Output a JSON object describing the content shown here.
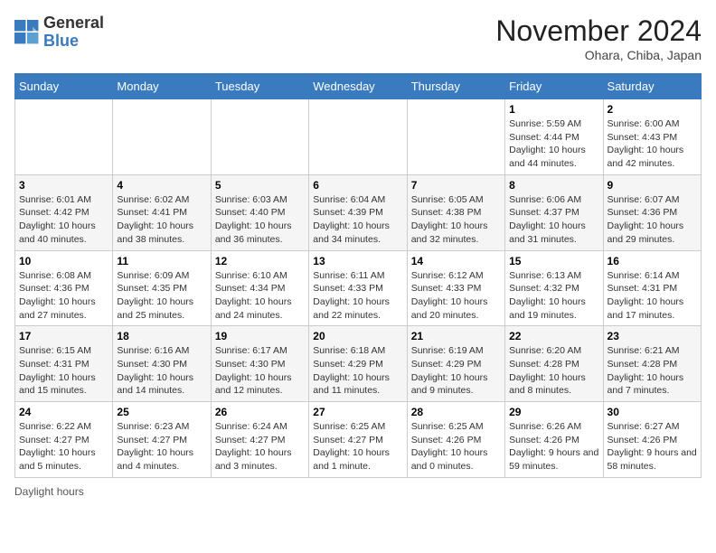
{
  "header": {
    "logo_general": "General",
    "logo_blue": "Blue",
    "month_title": "November 2024",
    "location": "Ohara, Chiba, Japan"
  },
  "days_of_week": [
    "Sunday",
    "Monday",
    "Tuesday",
    "Wednesday",
    "Thursday",
    "Friday",
    "Saturday"
  ],
  "footer": {
    "daylight_label": "Daylight hours"
  },
  "weeks": [
    [
      {
        "day": "",
        "info": ""
      },
      {
        "day": "",
        "info": ""
      },
      {
        "day": "",
        "info": ""
      },
      {
        "day": "",
        "info": ""
      },
      {
        "day": "",
        "info": ""
      },
      {
        "day": "1",
        "info": "Sunrise: 5:59 AM\nSunset: 4:44 PM\nDaylight: 10 hours and 44 minutes."
      },
      {
        "day": "2",
        "info": "Sunrise: 6:00 AM\nSunset: 4:43 PM\nDaylight: 10 hours and 42 minutes."
      }
    ],
    [
      {
        "day": "3",
        "info": "Sunrise: 6:01 AM\nSunset: 4:42 PM\nDaylight: 10 hours and 40 minutes."
      },
      {
        "day": "4",
        "info": "Sunrise: 6:02 AM\nSunset: 4:41 PM\nDaylight: 10 hours and 38 minutes."
      },
      {
        "day": "5",
        "info": "Sunrise: 6:03 AM\nSunset: 4:40 PM\nDaylight: 10 hours and 36 minutes."
      },
      {
        "day": "6",
        "info": "Sunrise: 6:04 AM\nSunset: 4:39 PM\nDaylight: 10 hours and 34 minutes."
      },
      {
        "day": "7",
        "info": "Sunrise: 6:05 AM\nSunset: 4:38 PM\nDaylight: 10 hours and 32 minutes."
      },
      {
        "day": "8",
        "info": "Sunrise: 6:06 AM\nSunset: 4:37 PM\nDaylight: 10 hours and 31 minutes."
      },
      {
        "day": "9",
        "info": "Sunrise: 6:07 AM\nSunset: 4:36 PM\nDaylight: 10 hours and 29 minutes."
      }
    ],
    [
      {
        "day": "10",
        "info": "Sunrise: 6:08 AM\nSunset: 4:36 PM\nDaylight: 10 hours and 27 minutes."
      },
      {
        "day": "11",
        "info": "Sunrise: 6:09 AM\nSunset: 4:35 PM\nDaylight: 10 hours and 25 minutes."
      },
      {
        "day": "12",
        "info": "Sunrise: 6:10 AM\nSunset: 4:34 PM\nDaylight: 10 hours and 24 minutes."
      },
      {
        "day": "13",
        "info": "Sunrise: 6:11 AM\nSunset: 4:33 PM\nDaylight: 10 hours and 22 minutes."
      },
      {
        "day": "14",
        "info": "Sunrise: 6:12 AM\nSunset: 4:33 PM\nDaylight: 10 hours and 20 minutes."
      },
      {
        "day": "15",
        "info": "Sunrise: 6:13 AM\nSunset: 4:32 PM\nDaylight: 10 hours and 19 minutes."
      },
      {
        "day": "16",
        "info": "Sunrise: 6:14 AM\nSunset: 4:31 PM\nDaylight: 10 hours and 17 minutes."
      }
    ],
    [
      {
        "day": "17",
        "info": "Sunrise: 6:15 AM\nSunset: 4:31 PM\nDaylight: 10 hours and 15 minutes."
      },
      {
        "day": "18",
        "info": "Sunrise: 6:16 AM\nSunset: 4:30 PM\nDaylight: 10 hours and 14 minutes."
      },
      {
        "day": "19",
        "info": "Sunrise: 6:17 AM\nSunset: 4:30 PM\nDaylight: 10 hours and 12 minutes."
      },
      {
        "day": "20",
        "info": "Sunrise: 6:18 AM\nSunset: 4:29 PM\nDaylight: 10 hours and 11 minutes."
      },
      {
        "day": "21",
        "info": "Sunrise: 6:19 AM\nSunset: 4:29 PM\nDaylight: 10 hours and 9 minutes."
      },
      {
        "day": "22",
        "info": "Sunrise: 6:20 AM\nSunset: 4:28 PM\nDaylight: 10 hours and 8 minutes."
      },
      {
        "day": "23",
        "info": "Sunrise: 6:21 AM\nSunset: 4:28 PM\nDaylight: 10 hours and 7 minutes."
      }
    ],
    [
      {
        "day": "24",
        "info": "Sunrise: 6:22 AM\nSunset: 4:27 PM\nDaylight: 10 hours and 5 minutes."
      },
      {
        "day": "25",
        "info": "Sunrise: 6:23 AM\nSunset: 4:27 PM\nDaylight: 10 hours and 4 minutes."
      },
      {
        "day": "26",
        "info": "Sunrise: 6:24 AM\nSunset: 4:27 PM\nDaylight: 10 hours and 3 minutes."
      },
      {
        "day": "27",
        "info": "Sunrise: 6:25 AM\nSunset: 4:27 PM\nDaylight: 10 hours and 1 minute."
      },
      {
        "day": "28",
        "info": "Sunrise: 6:25 AM\nSunset: 4:26 PM\nDaylight: 10 hours and 0 minutes."
      },
      {
        "day": "29",
        "info": "Sunrise: 6:26 AM\nSunset: 4:26 PM\nDaylight: 9 hours and 59 minutes."
      },
      {
        "day": "30",
        "info": "Sunrise: 6:27 AM\nSunset: 4:26 PM\nDaylight: 9 hours and 58 minutes."
      }
    ]
  ]
}
